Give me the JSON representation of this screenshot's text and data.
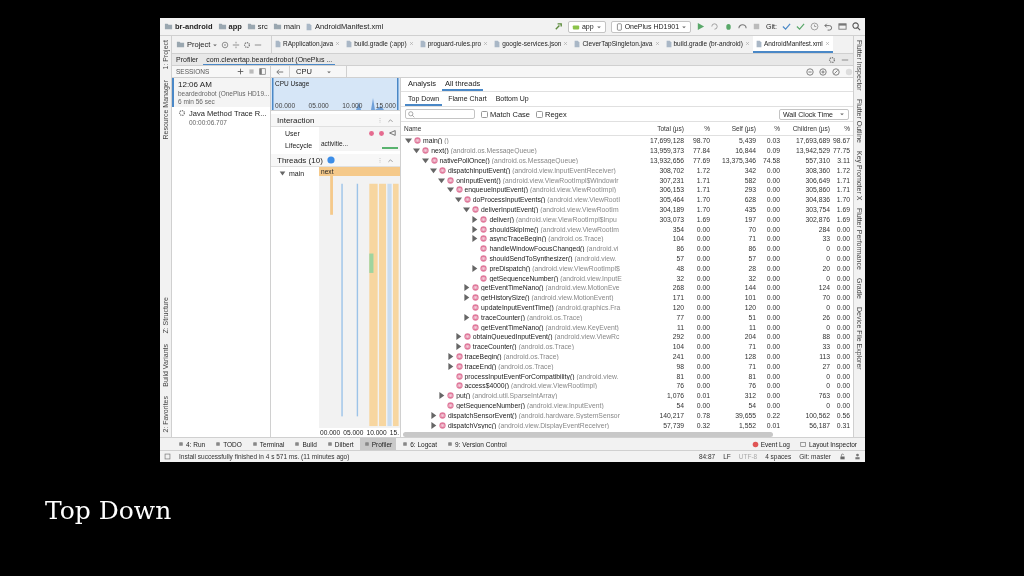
{
  "caption": "Top Down",
  "breadcrumbs": [
    "br-android",
    "app",
    "src",
    "main",
    "AndroidManifest.xml"
  ],
  "toolbar": {
    "run_config": "app",
    "device": "OnePlus HD1901",
    "git_label": "Git:"
  },
  "left_strip_top": [
    "1: Project",
    "Resource Manager"
  ],
  "left_strip_bottom": [
    "Z: Structure",
    "Build Variants",
    "2: Favorites"
  ],
  "right_strip": [
    "Flutter Inspector",
    "Flutter Outline",
    "Key Promoter X",
    "Flutter Performance",
    "Gradle",
    "Device File Explorer"
  ],
  "project_selector": "Project",
  "editor_tabs": [
    {
      "label": "RApplication.java",
      "selected": false
    },
    {
      "label": "build.gradle (:app)",
      "selected": false
    },
    {
      "label": "proguard-rules.pro",
      "selected": false
    },
    {
      "label": "google-services.json",
      "selected": false
    },
    {
      "label": "CleverTapSingleton.java",
      "selected": false
    },
    {
      "label": "build.gradle (br-android)",
      "selected": false
    },
    {
      "label": "AndroidManifest.xml",
      "selected": true
    }
  ],
  "profiler": {
    "title": "Profiler",
    "session_tab": "com.clevertap.beardedrobot (OnePlus ...",
    "sessions_label": "SESSIONS",
    "stage": "CPU"
  },
  "sessions": [
    {
      "time": "12:06 AM",
      "name": "beardedrobot (OnePlus HD19...",
      "duration": "6 min 56 sec",
      "selected": true
    }
  ],
  "traces": [
    {
      "name": "Java Method Trace R...",
      "time": "00:00:06.707"
    }
  ],
  "cpu_usage": {
    "label": "CPU Usage",
    "ticks": [
      "00.000",
      "05.000",
      "10.000",
      "15.000"
    ]
  },
  "interaction": {
    "title": "Interaction",
    "rows": [
      {
        "label": "User",
        "kind": "events"
      },
      {
        "label": "Lifecycle",
        "kind": "activity",
        "event": "activitie..."
      }
    ]
  },
  "threads": {
    "title": "Threads (10)",
    "items": [
      {
        "name": "main",
        "expanded": true,
        "event": "next"
      }
    ],
    "ticks": [
      "00.000",
      "05.000",
      "10.000",
      "15."
    ]
  },
  "analysis": {
    "tabs": [
      {
        "label": "Analysis",
        "selected": false
      },
      {
        "label": "All threads",
        "selected": true
      }
    ],
    "views": [
      {
        "label": "Top Down",
        "selected": true
      },
      {
        "label": "Flame Chart",
        "selected": false
      },
      {
        "label": "Bottom Up",
        "selected": false
      }
    ],
    "match_case": {
      "label": "Match Case",
      "checked": false
    },
    "regex": {
      "label": "Regex",
      "checked": false
    },
    "clock": "Wall Clock Time",
    "columns": [
      "Name",
      "Total (µs)",
      "%",
      "Self (µs)",
      "%",
      "Children (µs)",
      "%"
    ],
    "rows": [
      {
        "method": "main()",
        "cls": "()",
        "total": "17,699,128",
        "total_pct": "98.70",
        "self": "5,439",
        "self_pct": "0.03",
        "child_total": "17,693,689",
        "child_pct": "98.67",
        "expandable": true,
        "expanded": true,
        "children": [
          {
            "method": "next()",
            "cls": "(android.os.MessageQueue)",
            "total": "13,959,373",
            "total_pct": "77.84",
            "self": "16,844",
            "self_pct": "0.09",
            "child_total": "13,942,529",
            "child_pct": "77.75",
            "expandable": true,
            "expanded": true,
            "children": [
              {
                "method": "nativePollOnce()",
                "cls": "(android.os.MessageQueue)",
                "total": "13,932,656",
                "total_pct": "77.69",
                "self": "13,375,346",
                "self_pct": "74.58",
                "child_total": "557,310",
                "child_pct": "3.11",
                "expandable": true,
                "expanded": true,
                "children": [
                  {
                    "method": "dispatchInputEvent()",
                    "cls": "(android.view.InputEventReceiver)",
                    "total": "308,702",
                    "total_pct": "1.72",
                    "self": "342",
                    "self_pct": "0.00",
                    "child_total": "308,360",
                    "child_pct": "1.72",
                    "expandable": true,
                    "expanded": true,
                    "children": [
                      {
                        "method": "onInputEvent()",
                        "cls": "(android.view.ViewRootImpl$WindowIr",
                        "total": "307,231",
                        "total_pct": "1.71",
                        "self": "582",
                        "self_pct": "0.00",
                        "child_total": "306,649",
                        "child_pct": "1.71",
                        "expandable": true,
                        "expanded": true,
                        "children": [
                          {
                            "method": "enqueueInputEvent()",
                            "cls": "(android.view.ViewRootImpl)",
                            "total": "306,153",
                            "total_pct": "1.71",
                            "self": "293",
                            "self_pct": "0.00",
                            "child_total": "305,860",
                            "child_pct": "1.71",
                            "expandable": true,
                            "expanded": true,
                            "children": [
                              {
                                "method": "doProcessInputEvents()",
                                "cls": "(android.view.ViewRootI",
                                "total": "305,464",
                                "total_pct": "1.70",
                                "self": "628",
                                "self_pct": "0.00",
                                "child_total": "304,836",
                                "child_pct": "1.70",
                                "expandable": true,
                                "expanded": true,
                                "children": [
                                  {
                                    "method": "deliverInputEvent()",
                                    "cls": "(android.view.ViewRootIm",
                                    "total": "304,189",
                                    "total_pct": "1.70",
                                    "self": "435",
                                    "self_pct": "0.00",
                                    "child_total": "303,754",
                                    "child_pct": "1.69",
                                    "expandable": true,
                                    "expanded": true,
                                    "children": [
                                      {
                                        "method": "deliver()",
                                        "cls": "(android.view.ViewRootImpl$Inpu",
                                        "total": "303,073",
                                        "total_pct": "1.69",
                                        "self": "197",
                                        "self_pct": "0.00",
                                        "child_total": "302,876",
                                        "child_pct": "1.69",
                                        "expandable": true,
                                        "expanded": false
                                      },
                                      {
                                        "method": "shouldSkipIme()",
                                        "cls": "(android.view.ViewRootIm",
                                        "total": "354",
                                        "total_pct": "0.00",
                                        "self": "70",
                                        "self_pct": "0.00",
                                        "child_total": "284",
                                        "child_pct": "0.00",
                                        "expandable": true,
                                        "expanded": false
                                      },
                                      {
                                        "method": "asyncTraceBegin()",
                                        "cls": "(android.os.Trace)",
                                        "total": "104",
                                        "total_pct": "0.00",
                                        "self": "71",
                                        "self_pct": "0.00",
                                        "child_total": "33",
                                        "child_pct": "0.00",
                                        "expandable": true,
                                        "expanded": false
                                      },
                                      {
                                        "method": "handleWindowFocusChanged()",
                                        "cls": "(android.vi",
                                        "total": "86",
                                        "total_pct": "0.00",
                                        "self": "86",
                                        "self_pct": "0.00",
                                        "child_total": "0",
                                        "child_pct": "0.00",
                                        "expandable": false,
                                        "expanded": false
                                      },
                                      {
                                        "method": "shouldSendToSynthesizer()",
                                        "cls": "(android.view.",
                                        "total": "57",
                                        "total_pct": "0.00",
                                        "self": "57",
                                        "self_pct": "0.00",
                                        "child_total": "0",
                                        "child_pct": "0.00",
                                        "expandable": false,
                                        "expanded": false
                                      },
                                      {
                                        "method": "preDispatch()",
                                        "cls": "(android.view.ViewRootImpl$",
                                        "total": "48",
                                        "total_pct": "0.00",
                                        "self": "28",
                                        "self_pct": "0.00",
                                        "child_total": "20",
                                        "child_pct": "0.00",
                                        "expandable": true,
                                        "expanded": false
                                      },
                                      {
                                        "method": "getSequenceNumber()",
                                        "cls": "(android.view.InputE",
                                        "total": "32",
                                        "total_pct": "0.00",
                                        "self": "32",
                                        "self_pct": "0.00",
                                        "child_total": "0",
                                        "child_pct": "0.00",
                                        "expandable": false,
                                        "expanded": false
                                      }
                                    ]
                                  },
                                  {
                                    "method": "getEventTimeNano()",
                                    "cls": "(android.view.MotionEve",
                                    "total": "268",
                                    "total_pct": "0.00",
                                    "self": "144",
                                    "self_pct": "0.00",
                                    "child_total": "124",
                                    "child_pct": "0.00",
                                    "expandable": true,
                                    "expanded": false
                                  },
                                  {
                                    "method": "getHistorySize()",
                                    "cls": "(android.view.MotionEvent)",
                                    "total": "171",
                                    "total_pct": "0.00",
                                    "self": "101",
                                    "self_pct": "0.00",
                                    "child_total": "70",
                                    "child_pct": "0.00",
                                    "expandable": true,
                                    "expanded": false
                                  },
                                  {
                                    "method": "updateInputEventTime()",
                                    "cls": "(android.graphics.Fra",
                                    "total": "120",
                                    "total_pct": "0.00",
                                    "self": "120",
                                    "self_pct": "0.00",
                                    "child_total": "0",
                                    "child_pct": "0.00",
                                    "expandable": false,
                                    "expanded": false
                                  },
                                  {
                                    "method": "traceCounter()",
                                    "cls": "(android.os.Trace)",
                                    "total": "77",
                                    "total_pct": "0.00",
                                    "self": "51",
                                    "self_pct": "0.00",
                                    "child_total": "26",
                                    "child_pct": "0.00",
                                    "expandable": true,
                                    "expanded": false
                                  },
                                  {
                                    "method": "getEventTimeNano()",
                                    "cls": "(android.view.KeyEvent)",
                                    "total": "11",
                                    "total_pct": "0.00",
                                    "self": "11",
                                    "self_pct": "0.00",
                                    "child_total": "0",
                                    "child_pct": "0.00",
                                    "expandable": false,
                                    "expanded": false
                                  }
                                ]
                              },
                              {
                                "method": "obtainQueuedInputEvent()",
                                "cls": "(android.view.ViewRc",
                                "total": "292",
                                "total_pct": "0.00",
                                "self": "204",
                                "self_pct": "0.00",
                                "child_total": "88",
                                "child_pct": "0.00",
                                "expandable": true,
                                "expanded": false
                              },
                              {
                                "method": "traceCounter()",
                                "cls": "(android.os.Trace)",
                                "total": "104",
                                "total_pct": "0.00",
                                "self": "71",
                                "self_pct": "0.00",
                                "child_total": "33",
                                "child_pct": "0.00",
                                "expandable": true,
                                "expanded": false
                              }
                            ]
                          },
                          {
                            "method": "traceBegin()",
                            "cls": "(android.os.Trace)",
                            "total": "241",
                            "total_pct": "0.00",
                            "self": "128",
                            "self_pct": "0.00",
                            "child_total": "113",
                            "child_pct": "0.00",
                            "expandable": true,
                            "expanded": false
                          },
                          {
                            "method": "traceEnd()",
                            "cls": "(android.os.Trace)",
                            "total": "98",
                            "total_pct": "0.00",
                            "self": "71",
                            "self_pct": "0.00",
                            "child_total": "27",
                            "child_pct": "0.00",
                            "expandable": true,
                            "expanded": false
                          },
                          {
                            "method": "processInputEventForCompatibility()",
                            "cls": "(android.view.",
                            "total": "81",
                            "total_pct": "0.00",
                            "self": "81",
                            "self_pct": "0.00",
                            "child_total": "0",
                            "child_pct": "0.00",
                            "expandable": false,
                            "expanded": false
                          },
                          {
                            "method": "access$4000()",
                            "cls": "(android.view.ViewRootImpl)",
                            "total": "76",
                            "total_pct": "0.00",
                            "self": "76",
                            "self_pct": "0.00",
                            "child_total": "0",
                            "child_pct": "0.00",
                            "expandable": false,
                            "expanded": false
                          }
                        ]
                      },
                      {
                        "method": "put()",
                        "cls": "(android.util.SparseIntArray)",
                        "total": "1,076",
                        "total_pct": "0.01",
                        "self": "312",
                        "self_pct": "0.00",
                        "child_total": "763",
                        "child_pct": "0.00",
                        "expandable": true,
                        "expanded": false
                      },
                      {
                        "method": "getSequenceNumber()",
                        "cls": "(android.view.InputEvent)",
                        "total": "54",
                        "total_pct": "0.00",
                        "self": "54",
                        "self_pct": "0.00",
                        "child_total": "0",
                        "child_pct": "0.00",
                        "expandable": false,
                        "expanded": false
                      }
                    ]
                  },
                  {
                    "method": "dispatchSensorEvent()",
                    "cls": "(android.hardware.SystemSensor",
                    "total": "140,217",
                    "total_pct": "0.78",
                    "self": "39,655",
                    "self_pct": "0.22",
                    "child_total": "100,562",
                    "child_pct": "0.56",
                    "expandable": true,
                    "expanded": false
                  },
                  {
                    "method": "dispatchVsync()",
                    "cls": "(android.view.DisplayEventReceiver)",
                    "total": "57,739",
                    "total_pct": "0.32",
                    "self": "1,552",
                    "self_pct": "0.01",
                    "child_total": "56,187",
                    "child_pct": "0.31",
                    "expandable": true,
                    "expanded": false
                  }
                ]
              }
            ]
          }
        ]
      }
    ]
  },
  "bottom_tools": [
    {
      "label": "4: Run",
      "selected": false
    },
    {
      "label": "TODO",
      "selected": false
    },
    {
      "label": "Terminal",
      "selected": false
    },
    {
      "label": "Build",
      "selected": false
    },
    {
      "label": "Dilbert",
      "selected": false
    },
    {
      "label": "Profiler",
      "selected": true
    },
    {
      "label": "6: Logcat",
      "selected": false
    },
    {
      "label": "9: Version Control",
      "selected": false
    }
  ],
  "right_tools": [
    "Event Log",
    "Layout Inspector"
  ],
  "status": {
    "message": "Install successfully finished in 4 s 571 ms. (11 minutes ago)",
    "items": [
      {
        "label": "84:87",
        "disabled": false
      },
      {
        "label": "LF",
        "disabled": false
      },
      {
        "label": "UTF-8",
        "disabled": true
      },
      {
        "label": "4 spaces",
        "disabled": false
      },
      {
        "label": "Git: master",
        "disabled": false
      }
    ]
  }
}
